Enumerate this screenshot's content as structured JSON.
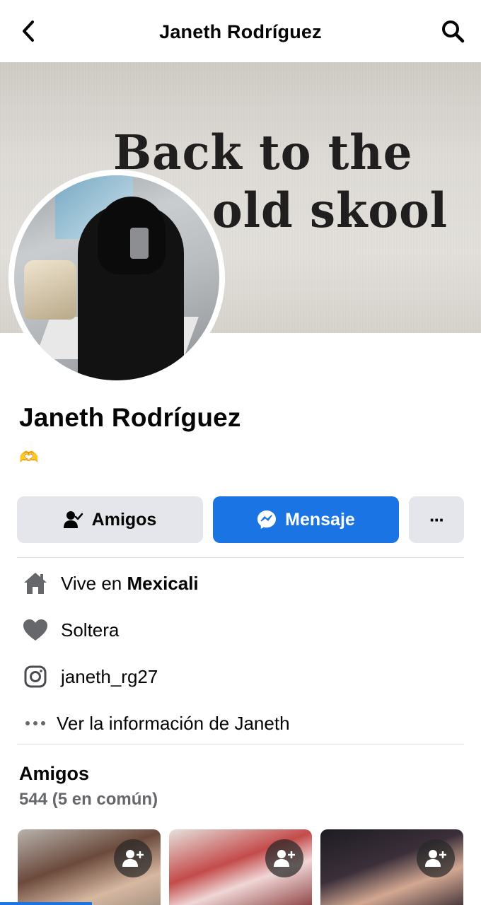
{
  "header": {
    "title": "Janeth Rodríguez"
  },
  "cover": {
    "text_line1": "Back to the",
    "text_line2": "old skool"
  },
  "profile": {
    "name": "Janeth Rodríguez",
    "bio": "🫶"
  },
  "actions": {
    "friends_label": "Amigos",
    "message_label": "Mensaje",
    "more_label": "···"
  },
  "info": {
    "lives_prefix": "Vive en ",
    "lives_city": "Mexicali",
    "relationship": "Soltera",
    "instagram": "janeth_rg27",
    "see_more": "Ver la información de Janeth"
  },
  "friends": {
    "title": "Amigos",
    "count_text": "544 (5 en común)"
  },
  "colors": {
    "accent": "#1b74e4",
    "button_gray": "#e4e6eb",
    "secondary_text": "#65676b"
  },
  "icons": [
    "back-arrow-icon",
    "search-icon",
    "friends-check-icon",
    "messenger-icon",
    "more-icon",
    "home-icon",
    "heart-icon",
    "instagram-icon",
    "ellipsis-icon",
    "add-friend-icon"
  ]
}
